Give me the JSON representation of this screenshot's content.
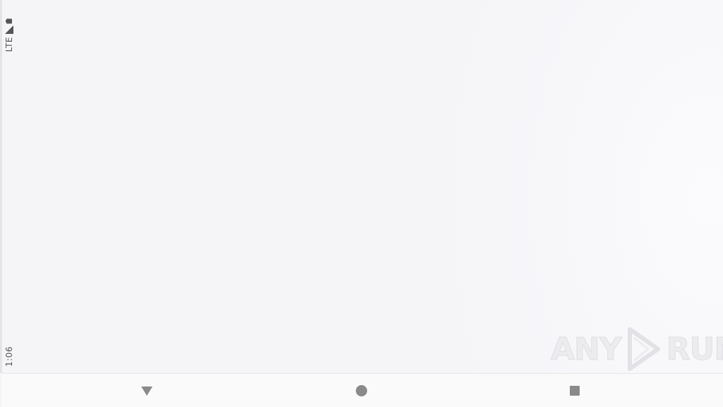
{
  "status_bar": {
    "network": "LTE",
    "time": "1:06",
    "icons": [
      "battery-icon",
      "signal-icon"
    ]
  },
  "nav_bar": {
    "buttons": [
      "back-icon",
      "home-icon",
      "recents-icon"
    ]
  },
  "watermark": {
    "left_text": "ANY",
    "right_text": "RUN"
  },
  "colors": {
    "background": "#f6f6f9",
    "nav_icon": "#8a8a8a",
    "status_text": "#555555"
  }
}
